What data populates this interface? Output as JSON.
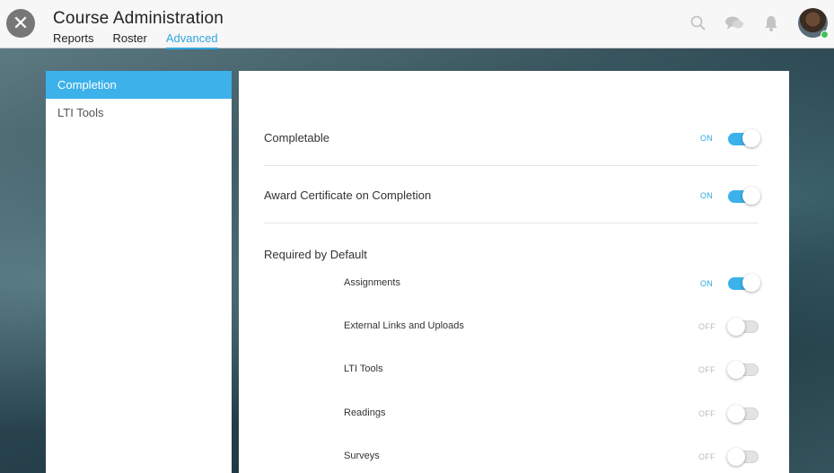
{
  "header": {
    "close_glyph": "✕",
    "title": "Course Administration",
    "tabs": [
      {
        "label": "Reports",
        "active": false
      },
      {
        "label": "Roster",
        "active": false
      },
      {
        "label": "Advanced",
        "active": true
      }
    ],
    "icons": [
      "search-icon",
      "chat-icon",
      "bell-icon"
    ],
    "avatar_status": "online"
  },
  "sidebar": {
    "items": [
      {
        "label": "Completion",
        "active": true
      },
      {
        "label": "LTI Tools",
        "active": false
      }
    ]
  },
  "settings": {
    "completable": {
      "label": "Completable",
      "state": "ON",
      "on": true
    },
    "award_certificate": {
      "label": "Award Certificate on Completion",
      "state": "ON",
      "on": true
    },
    "required_by_default": {
      "label": "Required by Default",
      "items": [
        {
          "label": "Assignments",
          "state": "ON",
          "on": true
        },
        {
          "label": "External Links and Uploads",
          "state": "OFF",
          "on": false
        },
        {
          "label": "LTI Tools",
          "state": "OFF",
          "on": false
        },
        {
          "label": "Readings",
          "state": "OFF",
          "on": false
        },
        {
          "label": "Surveys",
          "state": "OFF",
          "on": false
        }
      ]
    }
  },
  "colors": {
    "accent": "#3cb1ea",
    "header_bg": "#f7f7f7",
    "toggle_off": "#e3e3e3"
  }
}
